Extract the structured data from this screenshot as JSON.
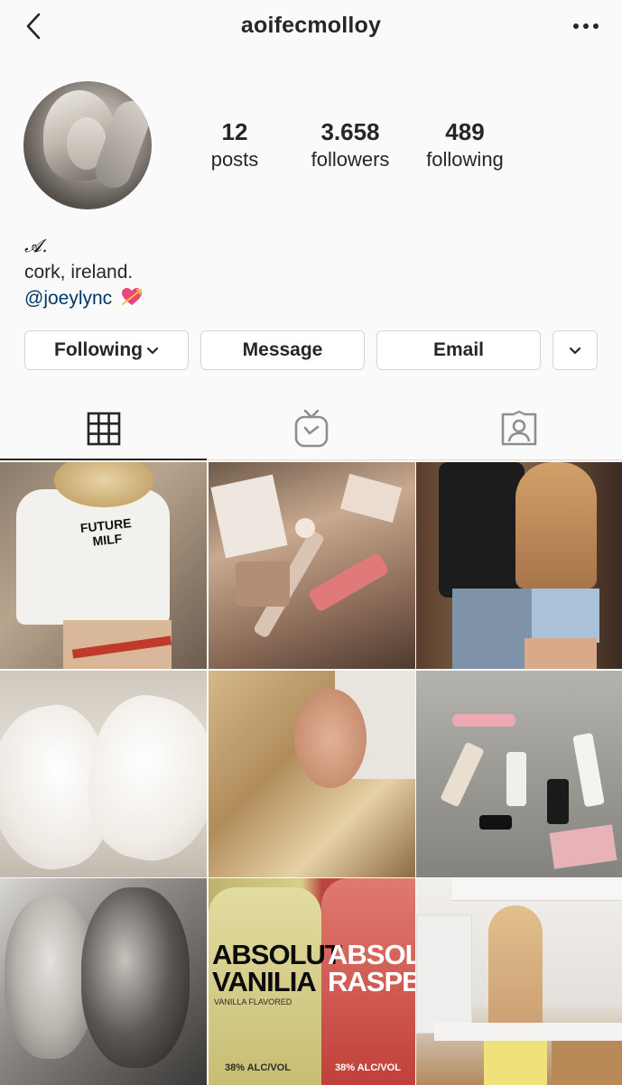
{
  "header": {
    "username": "aoifecmolloy"
  },
  "profile": {
    "posts_count": "12",
    "posts_label": "posts",
    "followers_count": "3.658",
    "followers_label": "followers",
    "following_count": "489",
    "following_label": "following",
    "display_name": "𝓐.",
    "bio_line": "cork, ireland.",
    "bio_mention": "@joeylync"
  },
  "actions": {
    "following_label": "Following",
    "message_label": "Message",
    "email_label": "Email"
  },
  "tabs": [
    {
      "name": "grid",
      "icon": "grid-icon",
      "active": true
    },
    {
      "name": "igtv",
      "icon": "igtv-icon",
      "active": false
    },
    {
      "name": "tagged",
      "icon": "tagged-icon",
      "active": false
    }
  ],
  "posts": [
    {
      "id": 1,
      "text": "FUTURE MILF"
    },
    {
      "id": 2,
      "text": ""
    },
    {
      "id": 3,
      "text": ""
    },
    {
      "id": 4,
      "text": ""
    },
    {
      "id": 5,
      "text": ""
    },
    {
      "id": 6,
      "text": ""
    },
    {
      "id": 7,
      "text": ""
    },
    {
      "id": 8,
      "text": "ABSOLUT VANILIA"
    },
    {
      "id": 9,
      "text": ""
    }
  ],
  "post_texts": {
    "p1_line1": "FUTURE",
    "p1_line2": "MILF",
    "p8_line1": "ABSOLUT",
    "p8_line2": "VANILIA",
    "p8b_line1": "ABSOLU",
    "p8b_line2": "RASPBE",
    "p8_sub": "VANILLA FLAVORED",
    "p8_vol": "38% ALC/VOL",
    "p8b_vol": "38% ALC/VOL"
  },
  "colors": {
    "accent_link": "#00376b",
    "text": "#262626",
    "border": "#dbdbdb"
  }
}
